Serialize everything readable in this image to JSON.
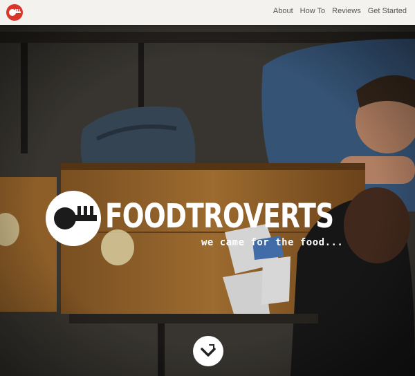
{
  "header": {
    "logo_icon": "fork-face-logo-icon",
    "nav": [
      {
        "label": "About"
      },
      {
        "label": "How To"
      },
      {
        "label": "Reviews"
      },
      {
        "label": "Get Started"
      }
    ]
  },
  "hero": {
    "brand_name": "FOODTROVERTS",
    "tagline": "we came for the food...",
    "brand_icon": "fork-face-logo-icon",
    "scroll_icon": "chevron-down-icon",
    "colors": {
      "accent": "#d9362c",
      "topbar": "#f4f2ef"
    }
  }
}
